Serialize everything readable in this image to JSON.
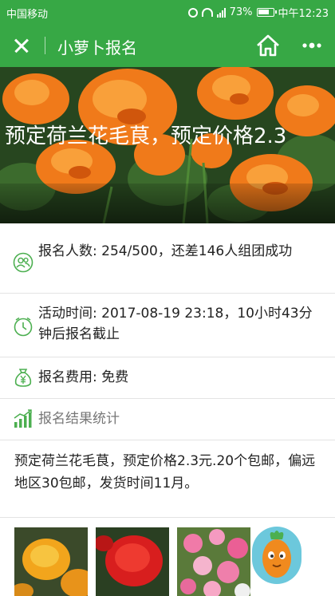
{
  "status_bar": {
    "carrier": "中国移动",
    "battery": "73%",
    "time": "中午12:23"
  },
  "header": {
    "title": "小萝卜报名"
  },
  "banner": {
    "caption": "预定荷兰花毛茛，预定价格2.3"
  },
  "info": {
    "signup_count": "报名人数: 254/500，还差146人组团成功",
    "activity_time": "活动时间: 2017-08-19 23:18，10小时43分钟后报名截止",
    "fee": "报名费用: 免费",
    "stats": "报名结果统计"
  },
  "description": "预定荷兰花毛茛，预定价格2.3元.20个包邮，偏远地区30包邮，发货时间11月。",
  "colors": {
    "brand_green": "#37a845",
    "icon_green": "#4caf50"
  }
}
